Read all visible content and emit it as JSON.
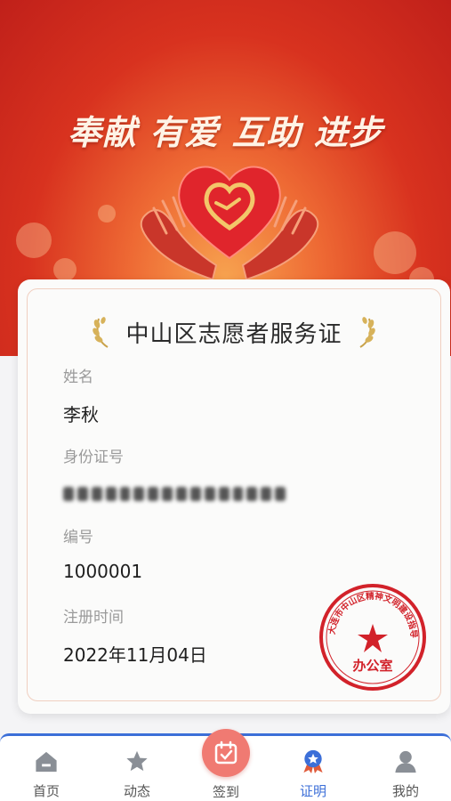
{
  "banner": {
    "slogan": "奉献 有爱 互助 进步"
  },
  "card": {
    "title": "中山区志愿者服务证",
    "fields": {
      "name_label": "姓名",
      "name_value": "李秋",
      "id_label": "身份证号",
      "number_label": "编号",
      "number_value": "1000001",
      "date_label": "注册时间",
      "date_value": "2022年11月04日"
    },
    "seal": {
      "ring_text": "大连市中山区精神文明建设指导委员会",
      "center_text": "办公室"
    }
  },
  "nav": {
    "items": [
      {
        "label": "首页",
        "icon": "home-icon"
      },
      {
        "label": "动态",
        "icon": "star-icon"
      },
      {
        "label": "签到",
        "icon": "calendar-check-icon"
      },
      {
        "label": "证明",
        "icon": "badge-icon",
        "active": true
      },
      {
        "label": "我的",
        "icon": "person-icon"
      }
    ]
  },
  "colors": {
    "banner_red": "#d8321f",
    "seal_red": "#d2222a",
    "active_blue": "#3c6fd8",
    "signin_pink": "#f07a72"
  }
}
